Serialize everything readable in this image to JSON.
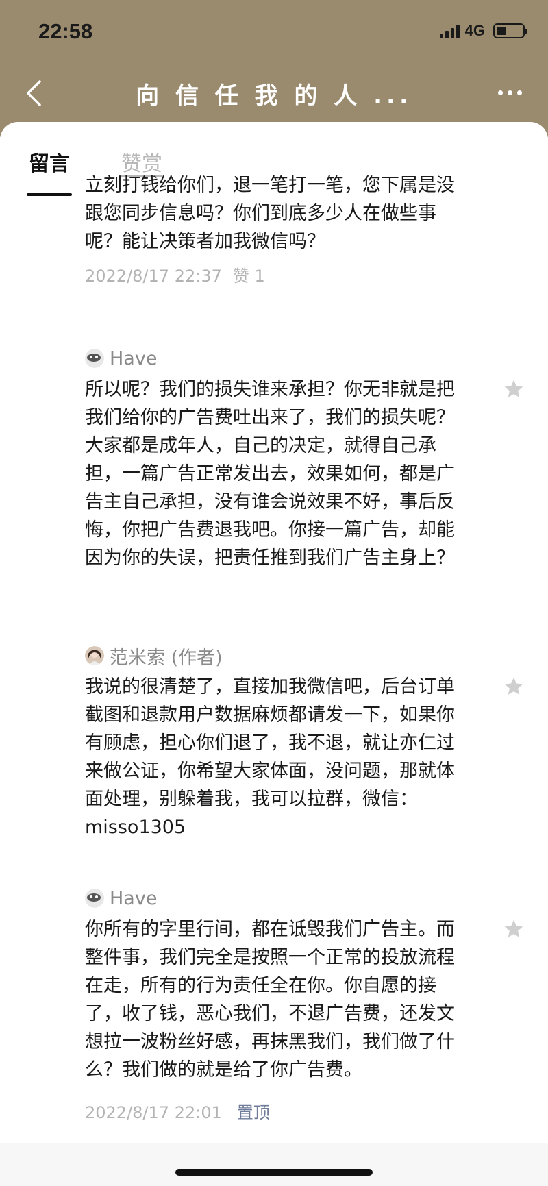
{
  "status_bar": {
    "time": "22:58",
    "network": "4G"
  },
  "nav": {
    "title": "向 信 任 我 的 人 ..."
  },
  "tabs": [
    {
      "label": "留言",
      "active": true
    },
    {
      "label": "赞赏",
      "active": false
    }
  ],
  "comments": [
    {
      "text": "立刻打钱给你们，退一笔打一笔，您下属是没跟您同步信息吗？你们到底多少人在做些事呢？能让决策者加我微信吗？",
      "date": "2022/8/17 22:37",
      "likes": "赞 1"
    },
    {
      "author": "Have",
      "text": "所以呢？我们的损失谁来承担？你无非就是把我们给你的广告费吐出来了，我们的损失呢？大家都是成年人，自己的决定，就得自己承担，一篇广告正常发出去，效果如何，都是广告主自己承担，没有谁会说效果不好，事后反悔，你把广告费退我吧。你接一篇广告，却能因为你的失误，把责任推到我们广告主身上？"
    },
    {
      "author": "范米索 (作者)",
      "text": "我说的很清楚了，直接加我微信吧，后台订单截图和退款用户数据麻烦都请发一下，如果你有顾虑，担心你们退了，我不退，就让亦仁过来做公证，你希望大家体面，没问题，那就体面处理，别躲着我，我可以拉群，微信：misso1305"
    },
    {
      "author": "Have",
      "text": "你所有的字里行间，都在诋毁我们广告主。而整件事，我们完全是按照一个正常的投放流程在走，所有的行为责任全在你。你自愿的接了，收了钱，恶心我们，不退广告费，还发文想拉一波粉丝好感，再抹黑我们，我们做了什么？我们做的就是给了你广告费。",
      "date": "2022/8/17 22:01",
      "action": "置顶"
    }
  ],
  "colors": {
    "header_bg": "#9a8b6f",
    "pin_blue": "#6e7b99"
  }
}
